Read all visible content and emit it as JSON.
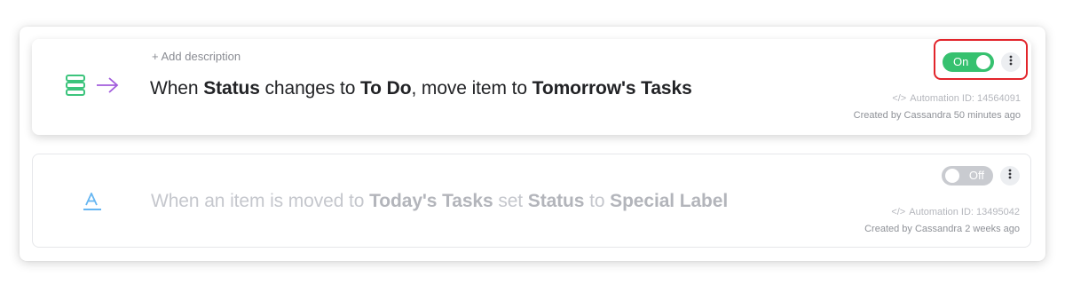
{
  "automations": [
    {
      "add_description": "+ Add description",
      "recipe": {
        "p1": "When ",
        "b1": "Status",
        "p2": " changes to ",
        "b2": "To Do",
        "p3": ", move item to ",
        "b3": "Tomorrow's Tasks"
      },
      "toggle_label": "On",
      "toggle_state": "on",
      "automation_id": "Automation ID: 14564091",
      "created": "Created by Cassandra 50 minutes ago",
      "icons": [
        "status-column-icon",
        "arrow-right-icon"
      ]
    },
    {
      "recipe": {
        "p1": "When an item is moved to ",
        "b1": "Today's Tasks",
        "p2": " set ",
        "b2": "Status",
        "p3": " to ",
        "b3": "Special Label"
      },
      "toggle_label": "Off",
      "toggle_state": "off",
      "automation_id": "Automation ID: 13495042",
      "created": "Created by Cassandra 2 weeks ago",
      "icons": [
        "text-label-icon"
      ]
    }
  ],
  "code_glyph": "</>",
  "colors": {
    "toggle_on": "#36c16f",
    "toggle_off": "#c9cbd0",
    "highlight": "#e2252b",
    "status_icon": "#3cc47c",
    "arrow_icon": "#a25ddc",
    "label_icon": "#66b6f2"
  }
}
